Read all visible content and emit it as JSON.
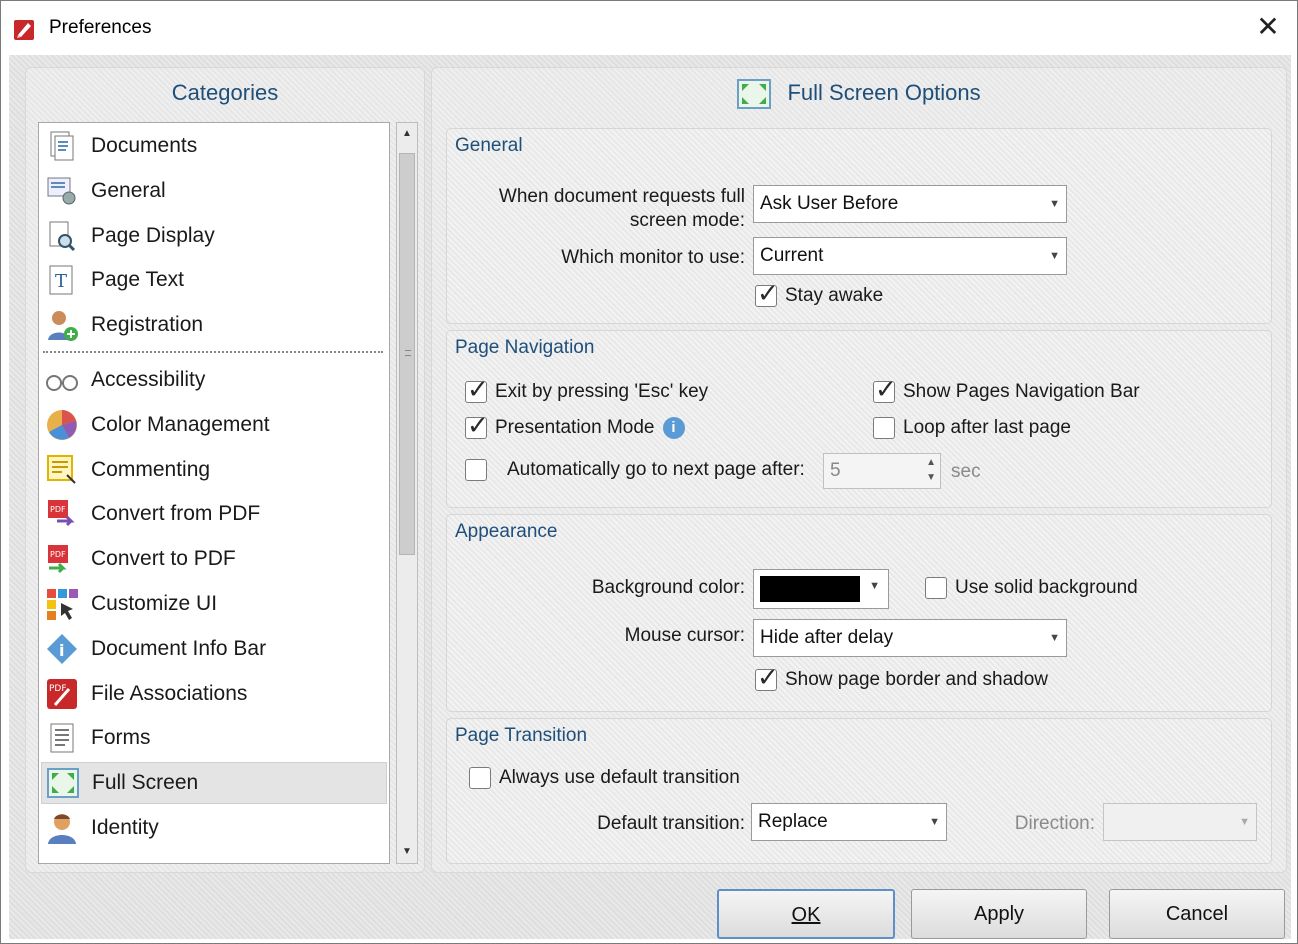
{
  "window": {
    "title": "Preferences",
    "close_glyph": "✕"
  },
  "categories": {
    "header": "Categories",
    "items": [
      {
        "label": "Documents",
        "icon": "documents-icon"
      },
      {
        "label": "General",
        "icon": "general-icon"
      },
      {
        "label": "Page Display",
        "icon": "page-display-icon"
      },
      {
        "label": "Page Text",
        "icon": "page-text-icon"
      },
      {
        "label": "Registration",
        "icon": "registration-icon"
      },
      {
        "label": "Accessibility",
        "icon": "accessibility-icon"
      },
      {
        "label": "Color Management",
        "icon": "color-management-icon"
      },
      {
        "label": "Commenting",
        "icon": "commenting-icon"
      },
      {
        "label": "Convert from PDF",
        "icon": "convert-from-pdf-icon"
      },
      {
        "label": "Convert to PDF",
        "icon": "convert-to-pdf-icon"
      },
      {
        "label": "Customize UI",
        "icon": "customize-ui-icon"
      },
      {
        "label": "Document Info Bar",
        "icon": "document-info-bar-icon"
      },
      {
        "label": "File Associations",
        "icon": "file-associations-icon"
      },
      {
        "label": "Forms",
        "icon": "forms-icon"
      },
      {
        "label": "Full Screen",
        "icon": "full-screen-icon"
      },
      {
        "label": "Identity",
        "icon": "identity-icon"
      }
    ],
    "selected": "Full Screen"
  },
  "options": {
    "header": "Full Screen Options",
    "general": {
      "title": "General",
      "request_label": "When document requests full screen mode:",
      "request_value": "Ask User Before",
      "monitor_label": "Which monitor to use:",
      "monitor_value": "Current",
      "stay_awake_label": "Stay awake",
      "stay_awake_checked": true
    },
    "navigation": {
      "title": "Page Navigation",
      "exit_esc_label": "Exit by pressing 'Esc' key",
      "exit_esc_checked": true,
      "show_nav_bar_label": "Show Pages Navigation Bar",
      "show_nav_bar_checked": true,
      "presentation_label": "Presentation Mode",
      "presentation_checked": true,
      "loop_label": "Loop after last page",
      "loop_checked": false,
      "auto_next_label": "Automatically go to next page after:",
      "auto_next_checked": false,
      "auto_next_value": "5",
      "auto_next_unit": "sec"
    },
    "appearance": {
      "title": "Appearance",
      "bg_color_label": "Background color:",
      "bg_color_value": "#000000",
      "solid_bg_label": "Use solid background",
      "solid_bg_checked": false,
      "cursor_label": "Mouse cursor:",
      "cursor_value": "Hide after delay",
      "border_shadow_label": "Show page border and shadow",
      "border_shadow_checked": true
    },
    "transition": {
      "title": "Page Transition",
      "always_default_label": "Always use default transition",
      "always_default_checked": false,
      "default_label": "Default transition:",
      "default_value": "Replace",
      "direction_label": "Direction:",
      "direction_value": ""
    }
  },
  "buttons": {
    "ok": "OK",
    "apply": "Apply",
    "cancel": "Cancel"
  }
}
